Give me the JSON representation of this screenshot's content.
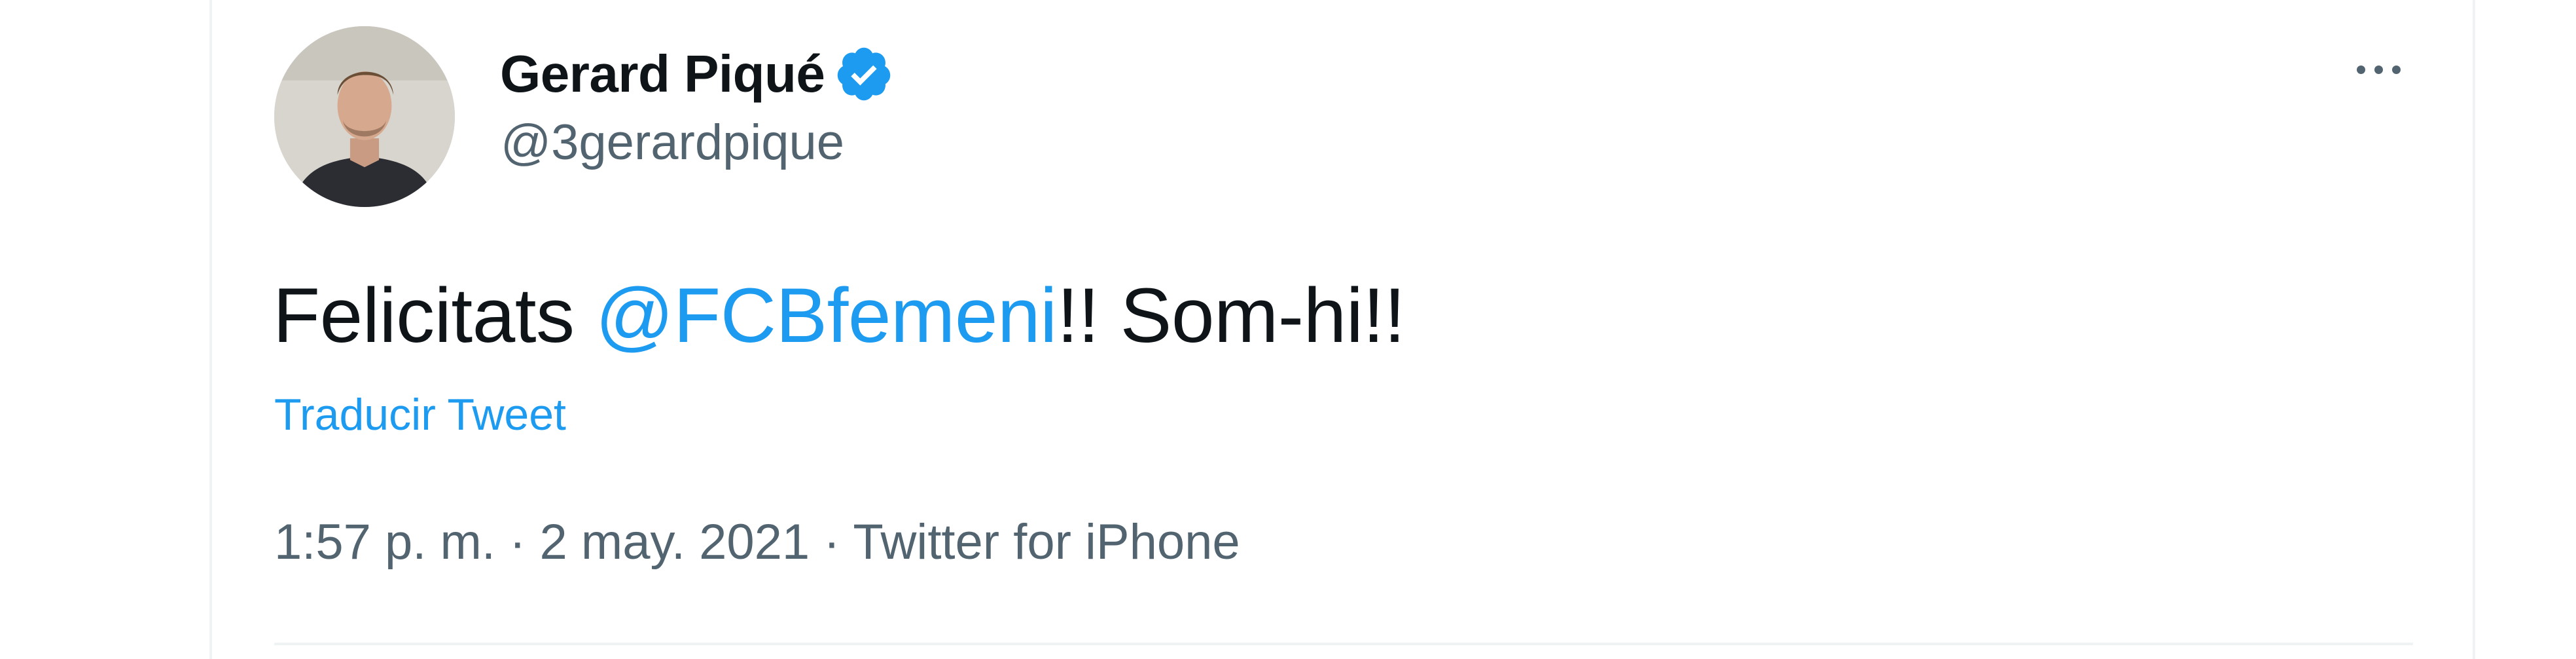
{
  "tweet": {
    "display_name": "Gerard Piqué",
    "handle": "@3gerardpique",
    "text_before": "Felicitats ",
    "mention": "@FCBfemeni",
    "text_after": "!! Som-hi!!",
    "translate_label": "Traducir Tweet",
    "time": "1:57 p. m.",
    "separator": " · ",
    "date": "2 may. 2021",
    "source": "Twitter for iPhone"
  },
  "icons": {
    "verified": "verified-badge-icon",
    "more": "more-options-icon"
  },
  "colors": {
    "accent": "#1d9bf0",
    "text_primary": "#0f1419",
    "text_secondary": "#536471",
    "border": "#eff3f4"
  }
}
